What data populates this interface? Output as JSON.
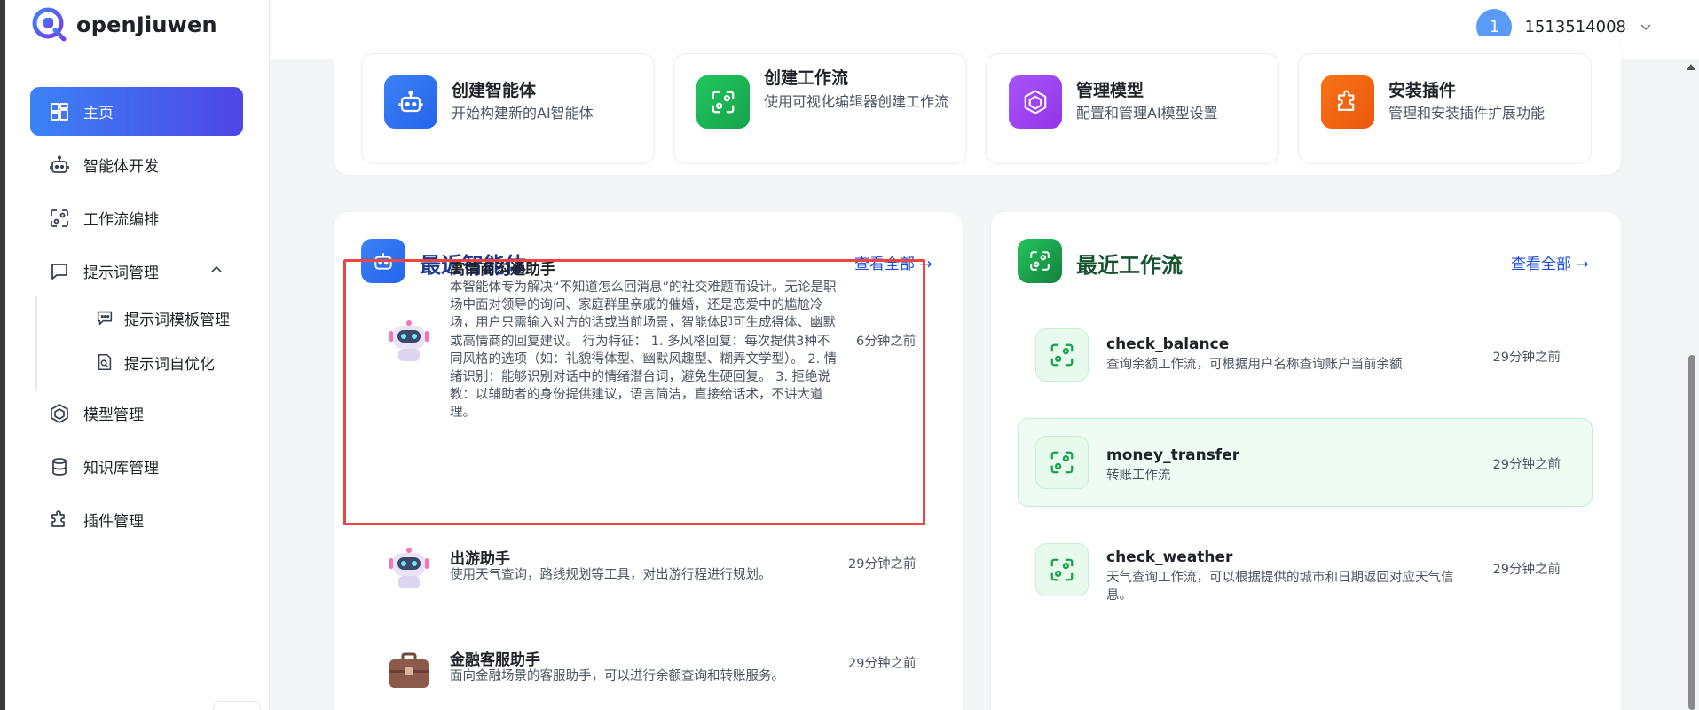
{
  "app": {
    "name": "openJiuwen"
  },
  "user": {
    "avatar_initial": "1",
    "username": "1513514008"
  },
  "sidebar": {
    "items": [
      {
        "label": "主页"
      },
      {
        "label": "智能体开发"
      },
      {
        "label": "工作流编排"
      },
      {
        "label": "提示词管理"
      },
      {
        "label": "模型管理"
      },
      {
        "label": "知识库管理"
      },
      {
        "label": "插件管理"
      }
    ],
    "sub_items": [
      {
        "label": "提示词模板管理"
      },
      {
        "label": "提示词自优化"
      }
    ]
  },
  "quick_actions": [
    {
      "title": "创建智能体",
      "desc": "开始构建新的AI智能体",
      "color": "#3b82f6"
    },
    {
      "title": "创建工作流",
      "desc": "使用可视化编辑器创建工作流",
      "color": "#22c55e"
    },
    {
      "title": "管理模型",
      "desc": "配置和管理AI模型设置",
      "color": "#a855f7"
    },
    {
      "title": "安装插件",
      "desc": "管理和安装插件扩展功能",
      "color": "#f97316"
    }
  ],
  "recent_agents": {
    "title": "最近智能体",
    "view_all": "查看全部 →",
    "items": [
      {
        "name": "高情商沟通助手",
        "desc": "本智能体专为解决“不知道怎么回消息”的社交难题而设计。无论是职场中面对领导的询问、家庭群里亲戚的催婚，还是恋爱中的尴尬冷场，用户只需输入对方的话或当前场景，智能体即可生成得体、幽默或高情商的回复建议。 行为特征： 1. 多风格回复：每次提供3种不同风格的选项（如：礼貌得体型、幽默风趣型、糊弄文学型）。 2. 情绪识别：能够识别对话中的情绪潜台词，避免生硬回复。 3. 拒绝说教：以辅助者的身份提供建议，语言简洁，直接给话术，不讲大道理。",
        "time": "6分钟之前"
      },
      {
        "name": "出游助手",
        "desc": "使用天气查询，路线规划等工具，对出游行程进行规划。",
        "time": "29分钟之前"
      },
      {
        "name": "金融客服助手",
        "desc": "面向金融场景的客服助手，可以进行余额查询和转账服务。",
        "time": "29分钟之前"
      }
    ]
  },
  "recent_workflows": {
    "title": "最近工作流",
    "view_all": "查看全部 →",
    "items": [
      {
        "name": "check_balance",
        "desc": "查询余额工作流，可根据用户名称查询账户当前余额",
        "time": "29分钟之前"
      },
      {
        "name": "money_transfer",
        "desc": "转账工作流",
        "time": "29分钟之前"
      },
      {
        "name": "check_weather",
        "desc": "天气查询工作流，可以根据提供的城市和日期返回对应天气信息。",
        "time": "29分钟之前"
      }
    ]
  },
  "colors": {
    "accent": "#4f46e5",
    "link": "#1d4ed8",
    "highlight": "#ef4444",
    "workflow_green": "#16a34a"
  }
}
